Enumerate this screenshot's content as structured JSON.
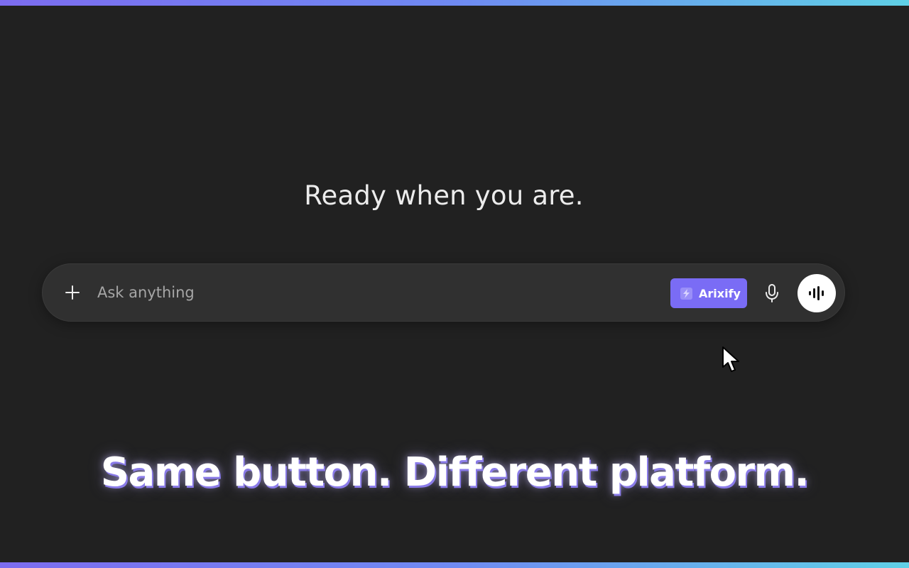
{
  "heading": "Ready when you are.",
  "composer": {
    "placeholder": "Ask anything",
    "value": "",
    "add_icon": "plus-icon",
    "arixify_label": "Arixify",
    "arixify_icon": "lightning-icon",
    "mic_icon": "microphone-icon",
    "voice_icon": "waveform-icon"
  },
  "caption": "Same button. Different platform.",
  "colors": {
    "background": "#212121",
    "composer": "#303030",
    "accent": "#7a6cf5",
    "gradient_start": "#7c6cf0",
    "gradient_end": "#5fd0e6"
  }
}
